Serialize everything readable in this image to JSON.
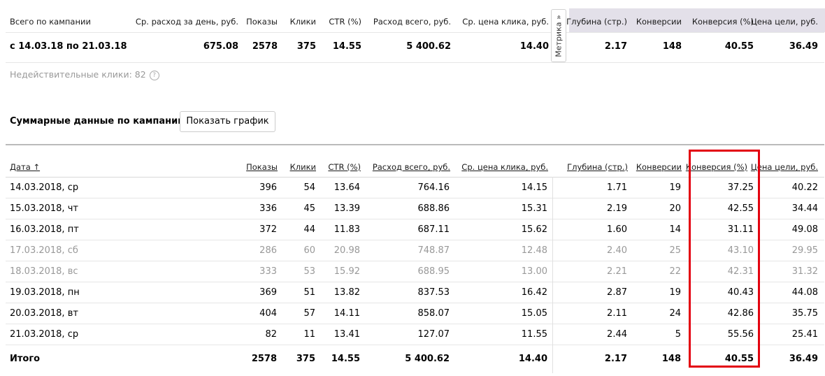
{
  "summary": {
    "headers": {
      "campaign": "Всего по кампании",
      "avg_spend": "Ср. расход за день, руб.",
      "impressions": "Показы",
      "clicks": "Клики",
      "ctr": "CTR (%)",
      "total_spend": "Расход всего, руб.",
      "avg_cpc": "Ср. цена клика, руб.",
      "depth": "Глубина (стр.)",
      "conversions": "Конверсии",
      "conv_rate": "Конверсия (%)",
      "goal_price": "Цена цели, руб."
    },
    "row": {
      "period": "с 14.03.18 по 21.03.18",
      "avg_spend": "675.08",
      "impressions": "2578",
      "clicks": "375",
      "ctr": "14.55",
      "total_spend": "5 400.62",
      "avg_cpc": "14.40",
      "depth": "2.17",
      "conversions": "148",
      "conv_rate": "40.55",
      "goal_price": "36.49"
    },
    "metrika_tab": "Метрика »",
    "metrika_bg_color": "#e3e0e9"
  },
  "invalid_clicks": "Недействительные клики: 82",
  "section_title": "Суммарные данные по кампании",
  "show_chart_button": "Показать график",
  "table": {
    "headers": {
      "date": "Дата ↑",
      "impressions": "Показы",
      "clicks": "Клики",
      "ctr": "CTR (%)",
      "total_spend": "Расход всего, руб.",
      "avg_cpc": "Ср. цена клика, руб.",
      "depth": "Глубина (стр.)",
      "conversions": "Конверсии",
      "conv_rate": "Конверсия (%)",
      "goal_price": "Цена цели, руб."
    },
    "rows": [
      {
        "date": "14.03.2018, ср",
        "impressions": "396",
        "clicks": "54",
        "ctr": "13.64",
        "total_spend": "764.16",
        "avg_cpc": "14.15",
        "depth": "1.71",
        "conversions": "19",
        "conv_rate": "37.25",
        "goal_price": "40.22",
        "weekend": false
      },
      {
        "date": "15.03.2018, чт",
        "impressions": "336",
        "clicks": "45",
        "ctr": "13.39",
        "total_spend": "688.86",
        "avg_cpc": "15.31",
        "depth": "2.19",
        "conversions": "20",
        "conv_rate": "42.55",
        "goal_price": "34.44",
        "weekend": false
      },
      {
        "date": "16.03.2018, пт",
        "impressions": "372",
        "clicks": "44",
        "ctr": "11.83",
        "total_spend": "687.11",
        "avg_cpc": "15.62",
        "depth": "1.60",
        "conversions": "14",
        "conv_rate": "31.11",
        "goal_price": "49.08",
        "weekend": false
      },
      {
        "date": "17.03.2018, сб",
        "impressions": "286",
        "clicks": "60",
        "ctr": "20.98",
        "total_spend": "748.87",
        "avg_cpc": "12.48",
        "depth": "2.40",
        "conversions": "25",
        "conv_rate": "43.10",
        "goal_price": "29.95",
        "weekend": true
      },
      {
        "date": "18.03.2018, вс",
        "impressions": "333",
        "clicks": "53",
        "ctr": "15.92",
        "total_spend": "688.95",
        "avg_cpc": "13.00",
        "depth": "2.21",
        "conversions": "22",
        "conv_rate": "42.31",
        "goal_price": "31.32",
        "weekend": true
      },
      {
        "date": "19.03.2018, пн",
        "impressions": "369",
        "clicks": "51",
        "ctr": "13.82",
        "total_spend": "837.53",
        "avg_cpc": "16.42",
        "depth": "2.87",
        "conversions": "19",
        "conv_rate": "40.43",
        "goal_price": "44.08",
        "weekend": false
      },
      {
        "date": "20.03.2018, вт",
        "impressions": "404",
        "clicks": "57",
        "ctr": "14.11",
        "total_spend": "858.07",
        "avg_cpc": "15.05",
        "depth": "2.11",
        "conversions": "24",
        "conv_rate": "42.86",
        "goal_price": "35.75",
        "weekend": false
      },
      {
        "date": "21.03.2018, ср",
        "impressions": "82",
        "clicks": "11",
        "ctr": "13.41",
        "total_spend": "127.07",
        "avg_cpc": "11.55",
        "depth": "2.44",
        "conversions": "5",
        "conv_rate": "55.56",
        "goal_price": "25.41",
        "weekend": false
      }
    ],
    "total": {
      "date": "Итого",
      "impressions": "2578",
      "clicks": "375",
      "ctr": "14.55",
      "total_spend": "5 400.62",
      "avg_cpc": "14.40",
      "depth": "2.17",
      "conversions": "148",
      "conv_rate": "40.55",
      "goal_price": "36.49"
    }
  },
  "highlight_color": "#e3000f"
}
